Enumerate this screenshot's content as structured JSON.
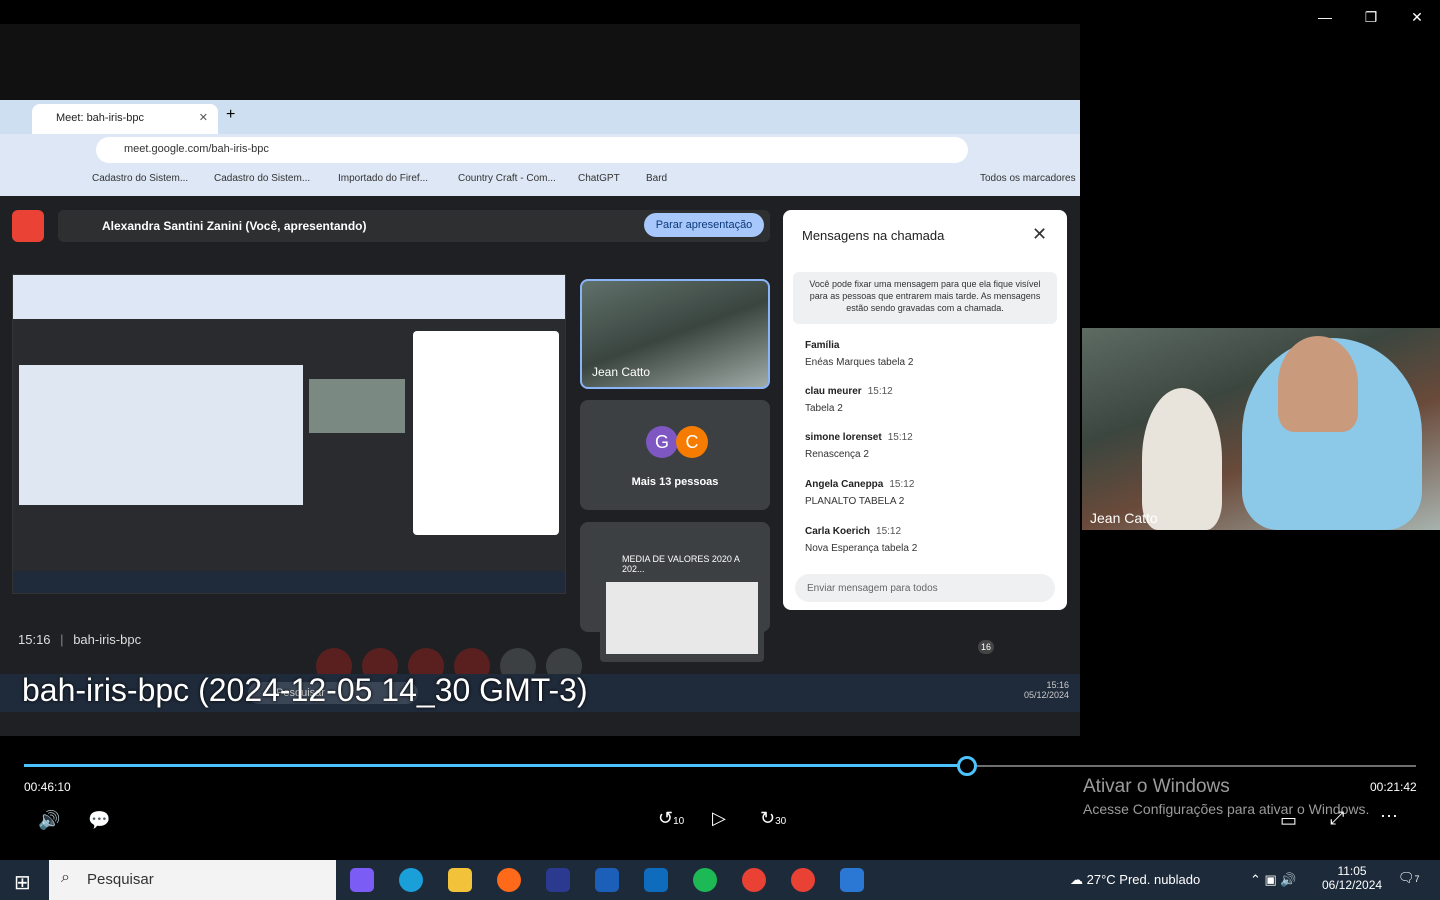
{
  "window": {
    "minimize": "—",
    "restore": "❐",
    "close": "✕"
  },
  "video": {
    "title": "bah-iris-bpc (2024-12-05 14_30 GMT-3)",
    "cam_name": "Jean Catto",
    "chrome": {
      "tab_title": "Meet: bah-iris-bpc",
      "url": "meet.google.com/bah-iris-bpc",
      "bookmarks": [
        "Cadastro do Sistem...",
        "Cadastro do Sistem...",
        "Importado do Firef...",
        "Country Craft - Com...",
        "ChatGPT",
        "Bard"
      ],
      "all_bookmarks": "Todos os marcadores"
    },
    "meet": {
      "presenting": "Alexandra Santini Zanini (Você, apresentando)",
      "stop_presenting": "Parar apresentação",
      "tile_name": "Jean Catto",
      "more_people": "Mais 13 pessoas",
      "avatars": [
        {
          "letter": "G",
          "color": "#7e57c2"
        },
        {
          "letter": "C",
          "color": "#f57c00"
        }
      ],
      "media_popup": "MEDIA DE VALORES 2020 A 202...",
      "time": "15:16",
      "meeting_code": "bah-iris-bpc",
      "people_count": "16",
      "chat": {
        "title": "Mensagens na chamada",
        "pin_note": "Você pode fixar uma mensagem para que ela fique visível para as pessoas que entrarem mais tarde. As mensagens estão sendo gravadas com a chamada.",
        "messages": [
          {
            "name": "Família",
            "time": "",
            "body": "Enéas Marques tabela 2"
          },
          {
            "name": "clau meurer",
            "time": "15:12",
            "body": "Tabela 2"
          },
          {
            "name": "simone lorenset",
            "time": "15:12",
            "body": "Renascença 2"
          },
          {
            "name": "Angela Caneppa",
            "time": "15:12",
            "body": "PLANALTO TABELA 2"
          },
          {
            "name": "Carla Koerich",
            "time": "15:12",
            "body": "Nova Esperança tabela 2"
          }
        ],
        "input_placeholder": "Enviar mensagem para todos"
      },
      "inner_taskbar": {
        "search": "Pesquisar",
        "time": "15:16",
        "date": "05/12/2024"
      }
    }
  },
  "player": {
    "elapsed": "00:46:10",
    "remaining": "00:21:42",
    "progress_fraction": 0.67,
    "skip_back": "10",
    "skip_fwd": "30"
  },
  "watermark": {
    "line1": "Ativar o Windows",
    "line2": "Acesse Configurações para ativar o Windows."
  },
  "taskbar": {
    "search": "Pesquisar",
    "weather": "27°C  Pred. nublado",
    "time": "11:05",
    "date": "06/12/2024",
    "notifications": "7"
  }
}
